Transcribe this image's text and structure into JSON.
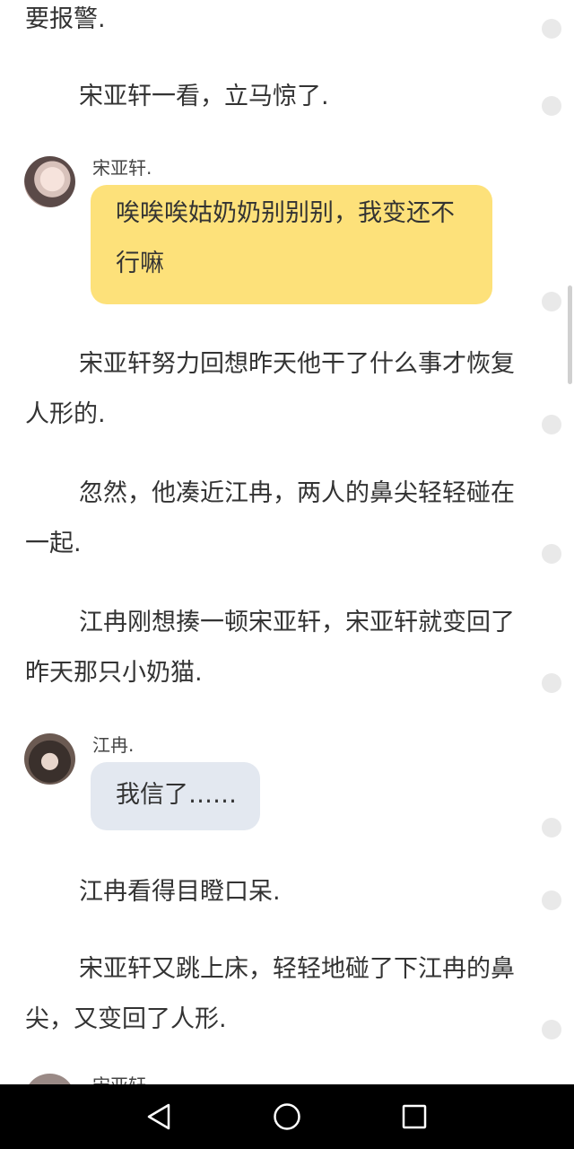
{
  "reader": {
    "paragraphs": [
      "要报警.",
      "宋亚轩一看，立马惊了.",
      "宋亚轩努力回想昨天他干了什么事才恢复人形的.",
      "忽然，他凑近江冉，两人的鼻尖轻轻碰在一起.",
      "江冉刚想揍一顿宋亚轩，宋亚轩就变回了昨天那只小奶猫.",
      "江冉看得目瞪口呆.",
      "宋亚轩又跳上床，轻轻地碰了下江冉的鼻尖，又变回了人形."
    ],
    "dialogs": [
      {
        "speaker": "宋亚轩.",
        "text": "唉唉唉姑奶奶别别别，我变还不行嘛",
        "bubble_color": "#fde17a"
      },
      {
        "speaker": "江冉.",
        "text": "我信了……",
        "bubble_color": "#e3e8f0"
      }
    ],
    "partial_speaker": "宋亚轩."
  },
  "navbar": {
    "back_icon": "back-triangle-icon",
    "home_icon": "home-circle-icon",
    "recents_icon": "recents-square-icon"
  }
}
